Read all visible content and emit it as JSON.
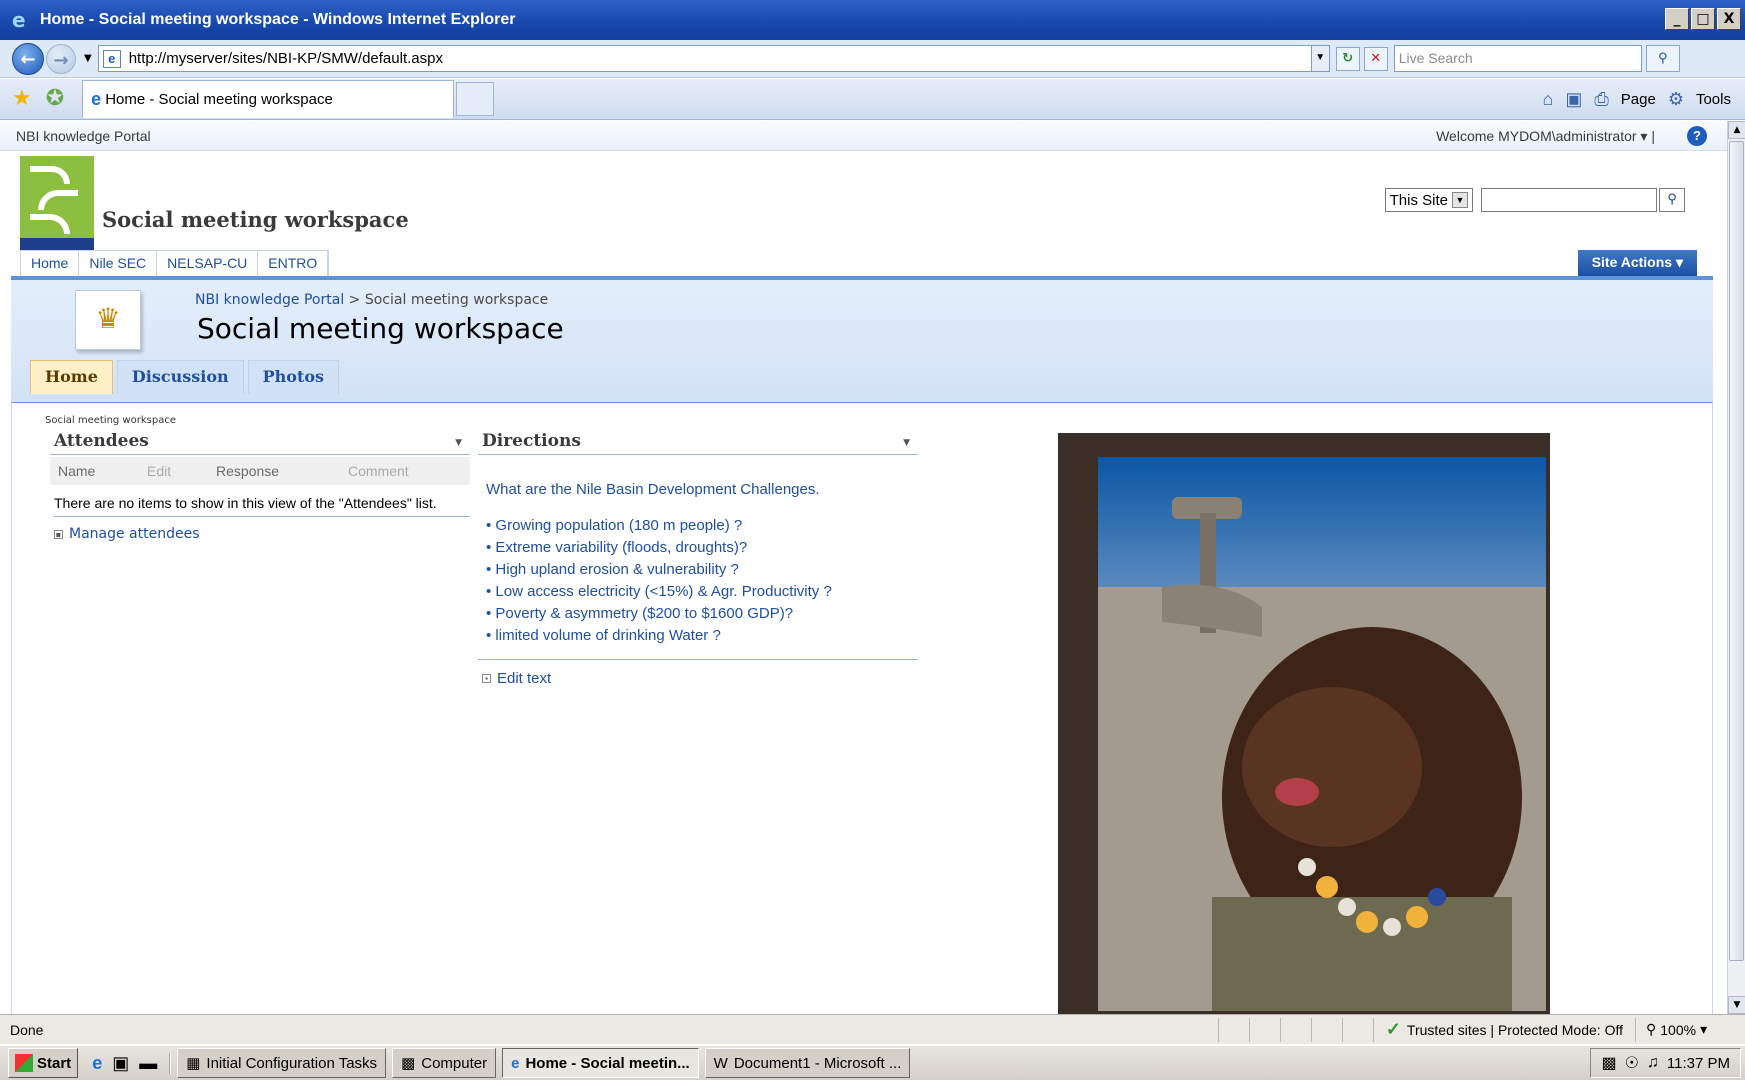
{
  "window": {
    "title": "Home - Social meeting workspace - Windows Internet Explorer",
    "controls": [
      "_",
      "□",
      "X"
    ]
  },
  "address_bar": {
    "url": "http://myserver/sites/NBI-KP/SMW/default.aspx",
    "search_placeholder": "Live Search"
  },
  "tab_bar": {
    "active_tab": "Home - Social meeting workspace",
    "commands": [
      "Page",
      "Tools"
    ]
  },
  "sharepoint": {
    "global_portal": "NBI knowledge Portal",
    "welcome": "Welcome MYDOM\\administrator",
    "site_title": "Social meeting workspace",
    "search_scope": "This Site",
    "top_nav": [
      "Home",
      "Nile SEC",
      "NELSAP-CU",
      "ENTRO"
    ],
    "site_actions": "Site Actions",
    "breadcrumb": {
      "root": "NBI knowledge Portal",
      "separator": ">",
      "current": "Social meeting workspace"
    },
    "page_title": "Social meeting workspace",
    "tabs": [
      "Home",
      "Discussion",
      "Photos"
    ],
    "zone_label": "Social meeting workspace"
  },
  "attendees": {
    "title": "Attendees",
    "columns": [
      "Name",
      "Edit",
      "Response",
      "Comment"
    ],
    "empty_message": "There are no items to show in this view of the \"Attendees\" list.",
    "manage_link": "Manage attendees"
  },
  "directions": {
    "title": "Directions",
    "intro": "What are the Nile Basin Development Challenges.",
    "items": [
      "Growing population (180 m people) ?",
      "Extreme variability (floods, droughts)?",
      "High upland erosion & vulnerability ?",
      "Low access electricity (<15%) & Agr. Productivity ?",
      "Poverty & asymmetry ($200 to $1600 GDP)?",
      "limited volume of drinking Water ?"
    ],
    "edit_link": "Edit text"
  },
  "status_bar": {
    "status": "Done",
    "zone": "Trusted sites | Protected Mode: Off",
    "zoom": "100%"
  },
  "taskbar": {
    "start": "Start",
    "buttons": [
      "Initial Configuration Tasks",
      "Computer",
      "Home - Social meetin...",
      "Document1 - Microsoft ..."
    ],
    "clock": "11:37 PM"
  },
  "colors": {
    "ie_title": "#1a4bb0",
    "sp_link": "#1f4fa3",
    "site_actions": "#1c4fa3",
    "active_tab": "#fff0c8"
  }
}
